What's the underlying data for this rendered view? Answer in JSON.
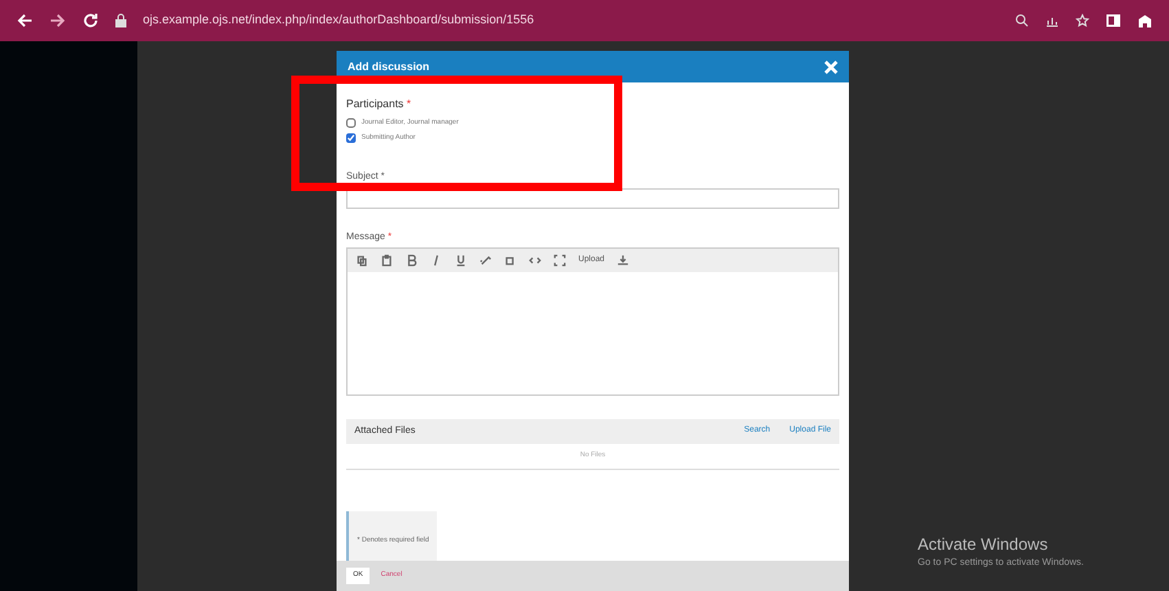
{
  "browser": {
    "url": "ojs.example.ojs.net/index.php/index/authorDashboard/submission/1556"
  },
  "modal": {
    "title": "Add discussion",
    "participants_label": "Participants",
    "participants_mark": "*",
    "participants": [
      {
        "name": "Journal Editor, Journal manager",
        "checked": false
      },
      {
        "name": "Submitting Author",
        "checked": true
      }
    ],
    "subject_label": "Subject",
    "subject_mark": "*",
    "message_label": "Message",
    "message_mark": "*",
    "toolbar": [
      {
        "kind": "icon"
      },
      {
        "kind": "icon"
      },
      {
        "kind": "icon"
      },
      {
        "kind": "icon"
      },
      {
        "kind": "icon"
      },
      {
        "kind": "icon"
      },
      {
        "kind": "icon"
      },
      {
        "kind": "icon"
      },
      {
        "kind": "icon"
      },
      {
        "kind": "text",
        "label": "Upload"
      },
      {
        "kind": "icon"
      }
    ],
    "files_title": "Attached Files",
    "search": "Search",
    "upload": "Upload File",
    "no_files": "No Files",
    "required_note": "* Denotes required field",
    "ok": "OK",
    "cancel": "Cancel"
  },
  "windows_notice": {
    "title": "Activate Windows",
    "text": "Go to PC settings to activate Windows."
  }
}
